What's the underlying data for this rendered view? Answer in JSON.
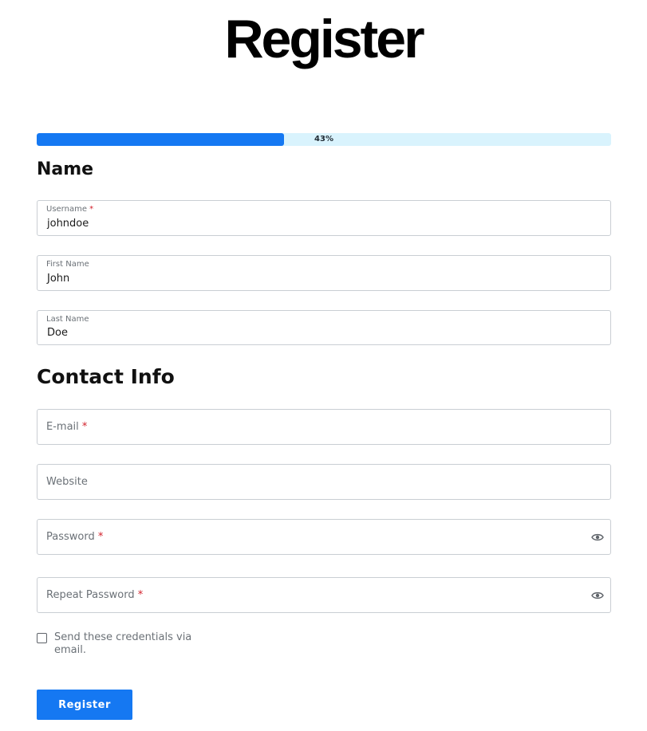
{
  "page": {
    "title": "Register"
  },
  "progress": {
    "label": "43%",
    "fraction": 0.43,
    "fill_color": "#1578f2",
    "track_color": "#d9f3fd"
  },
  "sections": {
    "name": "Name",
    "contact": "Contact Info"
  },
  "fields": {
    "username": {
      "label": "Username",
      "required_mark": "*",
      "value": "johndoe"
    },
    "first_name": {
      "label": "First Name",
      "value": "John"
    },
    "last_name": {
      "label": "Last Name",
      "value": "Doe"
    },
    "email": {
      "placeholder": "E-mail",
      "required_mark": "*"
    },
    "website": {
      "placeholder": "Website"
    },
    "password": {
      "placeholder": "Password",
      "required_mark": "*",
      "icon": "eye-icon"
    },
    "repeat_password": {
      "placeholder": "Repeat Password",
      "required_mark": "*",
      "icon": "eye-icon"
    }
  },
  "send_credentials": {
    "label": "Send these credentials via email.",
    "checked": false
  },
  "register_button": {
    "label": "Register",
    "color": "#1578f2"
  },
  "colors": {
    "required": "#d21f2a"
  }
}
